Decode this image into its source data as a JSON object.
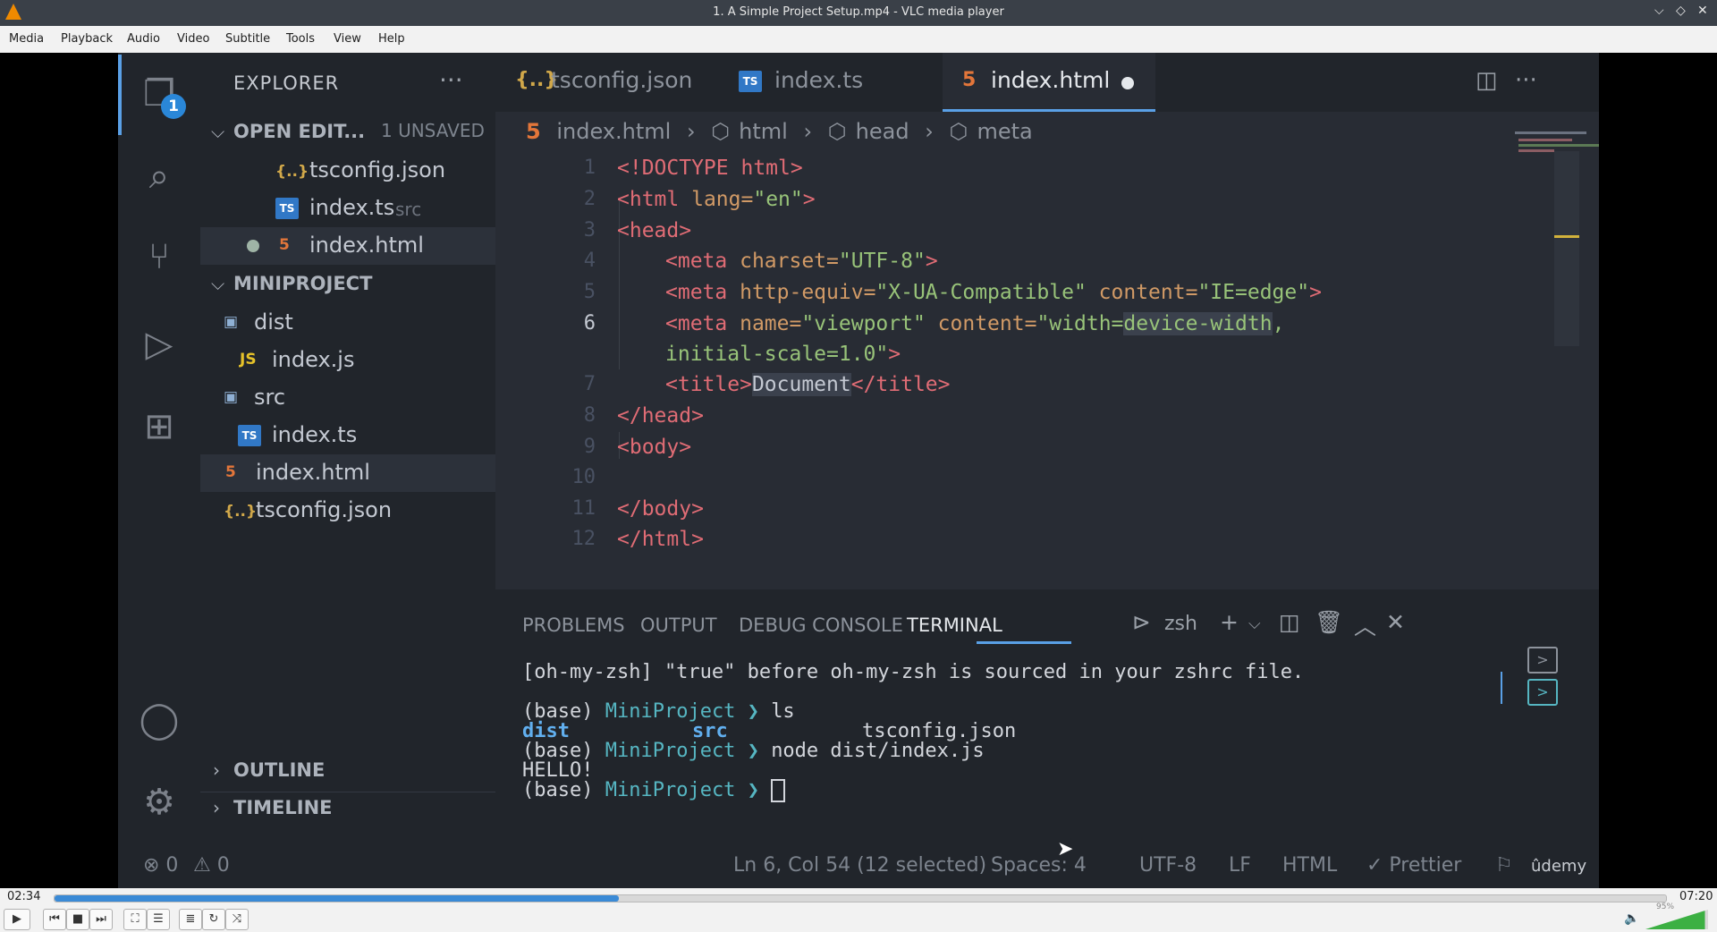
{
  "window": {
    "title": "1. A Simple Project Setup.mp4 - VLC media player",
    "controls": [
      "⌵",
      "◇",
      "✕"
    ]
  },
  "menu": [
    "Media",
    "Playback",
    "Audio",
    "Video",
    "Subtitle",
    "Tools",
    "View",
    "Help"
  ],
  "activity": {
    "badge": "1"
  },
  "explorer": {
    "title": "EXPLORER",
    "more": "···",
    "open_editors": {
      "label": "OPEN EDIT...",
      "unsaved": "1 UNSAVED",
      "items": [
        {
          "icon": "{..}",
          "name": "tsconfig.json",
          "sub": ""
        },
        {
          "icon": "TS",
          "name": "index.ts",
          "sub": "src"
        },
        {
          "icon": "5",
          "name": "index.html",
          "sub": ""
        }
      ]
    },
    "project": {
      "label": "MINIPROJECT",
      "items": [
        {
          "icon": "▣",
          "name": "dist"
        },
        {
          "icon": "JS",
          "name": "index.js"
        },
        {
          "icon": "▣",
          "name": "src"
        },
        {
          "icon": "TS",
          "name": "index.ts"
        },
        {
          "icon": "5",
          "name": "index.html"
        },
        {
          "icon": "{..}",
          "name": "tsconfig.json"
        }
      ]
    },
    "outline": "OUTLINE",
    "timeline": "TIMELINE"
  },
  "tabs": [
    {
      "icon": "{..}",
      "label": "tsconfig.json"
    },
    {
      "icon": "TS",
      "label": "index.ts"
    },
    {
      "icon": "5",
      "label": "index.html"
    }
  ],
  "breadcrumbs": [
    "index.html",
    "html",
    "head",
    "meta"
  ],
  "code_lines": [
    {
      "n": "1",
      "parts": [
        [
          "tag",
          "<!DOCTYPE html>"
        ]
      ]
    },
    {
      "n": "2",
      "parts": [
        [
          "tag",
          "<html "
        ],
        [
          "attr",
          "lang="
        ],
        [
          "str",
          "\"en\""
        ],
        [
          "tag",
          ">"
        ]
      ]
    },
    {
      "n": "3",
      "parts": [
        [
          "tag",
          "<head>"
        ]
      ]
    },
    {
      "n": "4",
      "parts": [
        [
          "tag",
          "<meta "
        ],
        [
          "attr",
          "charset="
        ],
        [
          "str",
          "\"UTF-8\""
        ],
        [
          "tag",
          ">"
        ]
      ]
    },
    {
      "n": "5",
      "parts": [
        [
          "tag",
          "<meta "
        ],
        [
          "attr",
          "http-equiv="
        ],
        [
          "str",
          "\"X-UA-Compatible\" "
        ],
        [
          "attr",
          "content="
        ],
        [
          "str",
          "\"IE=edge\""
        ],
        [
          "tag",
          ">"
        ]
      ]
    },
    {
      "n": "6",
      "parts": [
        [
          "tag",
          "<meta "
        ],
        [
          "attr",
          "name="
        ],
        [
          "str",
          "\"viewport\" "
        ],
        [
          "attr",
          "content="
        ],
        [
          "str",
          "\"width="
        ],
        [
          "strhl",
          "device-width"
        ],
        [
          "str",
          ","
        ]
      ]
    },
    {
      "n": "",
      "parts": [
        [
          "str",
          "initial-scale=1.0\""
        ],
        [
          "tag",
          ">"
        ]
      ]
    },
    {
      "n": "7",
      "parts": [
        [
          "tag",
          "<title>"
        ],
        [
          "txthl",
          "Document"
        ],
        [
          "tag",
          "</title>"
        ]
      ]
    },
    {
      "n": "8",
      "parts": [
        [
          "tag",
          "</head>"
        ]
      ]
    },
    {
      "n": "9",
      "parts": [
        [
          "tag",
          "<body>"
        ]
      ]
    },
    {
      "n": "10",
      "parts": []
    },
    {
      "n": "11",
      "parts": [
        [
          "tag",
          "</body>"
        ]
      ]
    },
    {
      "n": "12",
      "parts": [
        [
          "tag",
          "</html>"
        ]
      ]
    }
  ],
  "panel": {
    "tabs": [
      "PROBLEMS",
      "OUTPUT",
      "DEBUG CONSOLE",
      "TERMINAL"
    ],
    "shell": "zsh",
    "terminal": {
      "l1": "[oh-my-zsh] \"true\" before oh-my-zsh is sourced in your zshrc file.",
      "base": "(base)",
      "dir": "MiniProject",
      "arrow": "❯",
      "cmd1": "ls",
      "ls_dist": "dist",
      "ls_src": "src",
      "ls_ts": "tsconfig.json",
      "cmd2": "node dist/index.js",
      "out": "HELLO!"
    }
  },
  "status": {
    "errors": "⊗ 0",
    "warnings": "⚠ 0",
    "position": "Ln 6, Col 54 (12 selected)",
    "spaces": "Spaces: 4",
    "encoding": "UTF-8",
    "eol": "LF",
    "language": "HTML",
    "prettier": "✓ Prettier",
    "watermark": "ûdemy"
  },
  "player": {
    "elapsed": "02:34",
    "total": "07:20",
    "progress": 0.35,
    "volume_pct": "95%",
    "volume": 0.95
  }
}
